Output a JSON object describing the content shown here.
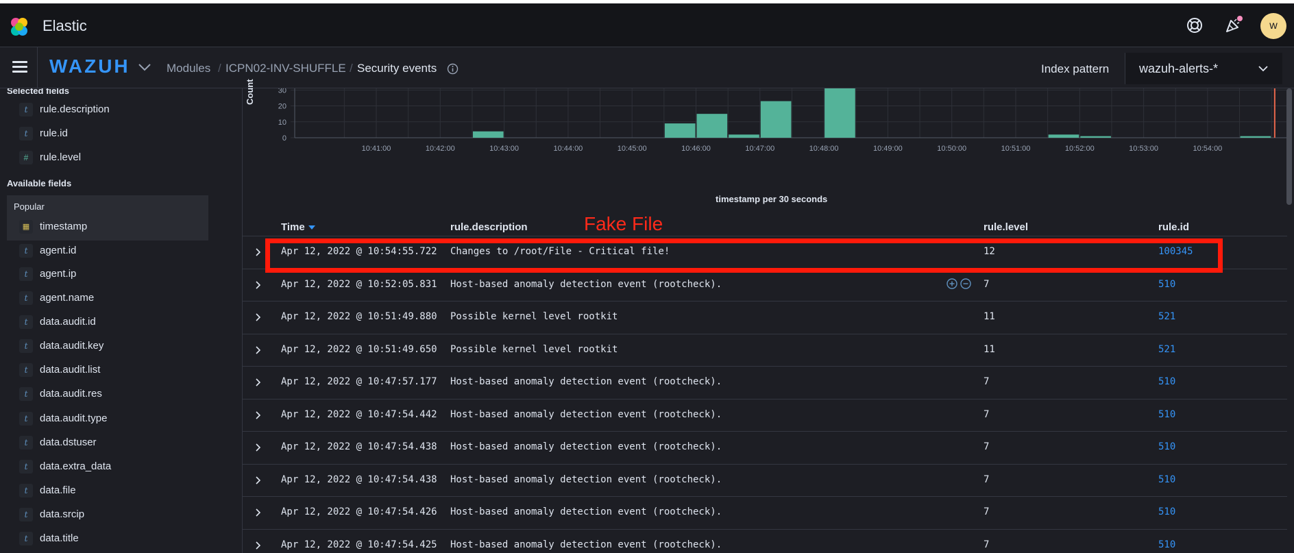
{
  "header": {
    "brand": "Elastic",
    "icons": [
      "help-icon",
      "news-feed-icon"
    ],
    "avatar_initial": "w"
  },
  "nav": {
    "app_name": "WAZUH",
    "breadcrumbs": [
      "Modules",
      "ICPN02-INV-SHUFFLE",
      "Security events"
    ],
    "index_pattern_label": "Index pattern",
    "index_pattern_value": "wazuh-alerts-*"
  },
  "sidebar": {
    "selected_heading": "Selected fields",
    "selected_fields": [
      {
        "name": "rule.description",
        "type": "t"
      },
      {
        "name": "rule.id",
        "type": "t"
      },
      {
        "name": "rule.level",
        "type": "#"
      }
    ],
    "available_heading": "Available fields",
    "popular_label": "Popular",
    "available_fields": [
      {
        "name": "timestamp",
        "type": "date"
      },
      {
        "name": "agent.id",
        "type": "t"
      },
      {
        "name": "agent.ip",
        "type": "t"
      },
      {
        "name": "agent.name",
        "type": "t"
      },
      {
        "name": "data.audit.id",
        "type": "t"
      },
      {
        "name": "data.audit.key",
        "type": "t"
      },
      {
        "name": "data.audit.list",
        "type": "t"
      },
      {
        "name": "data.audit.res",
        "type": "t"
      },
      {
        "name": "data.audit.type",
        "type": "t"
      },
      {
        "name": "data.dstuser",
        "type": "t"
      },
      {
        "name": "data.extra_data",
        "type": "t"
      },
      {
        "name": "data.file",
        "type": "t"
      },
      {
        "name": "data.srcip",
        "type": "t"
      },
      {
        "name": "data.title",
        "type": "t"
      }
    ]
  },
  "chart_data": {
    "type": "bar",
    "xlabel": "timestamp per 30 seconds",
    "ylabel": "Count",
    "ylim": [
      0,
      31
    ],
    "yticks": [
      0,
      10,
      20,
      30
    ],
    "xticks": [
      "10:41:00",
      "10:42:00",
      "10:43:00",
      "10:44:00",
      "10:45:00",
      "10:46:00",
      "10:47:00",
      "10:48:00",
      "10:49:00",
      "10:50:00",
      "10:51:00",
      "10:52:00",
      "10:53:00",
      "10:54:00"
    ],
    "bucket_minutes_from_1040": [
      2.75,
      5.75,
      6.25,
      6.75,
      7.25,
      8.25,
      11.75,
      12.25,
      14.75
    ],
    "values": [
      4,
      9,
      15,
      2,
      23,
      31,
      2,
      1,
      1
    ],
    "bar_color": "#54b399",
    "marker_color": "#e7664c"
  },
  "table": {
    "columns": [
      "Time",
      "rule.description",
      "rule.level",
      "rule.id"
    ],
    "rows": [
      {
        "time": "Apr 12, 2022 @ 10:54:55.722",
        "description": "Changes to /root/File - Critical file!",
        "level": "12",
        "id": "100345"
      },
      {
        "time": "Apr 12, 2022 @ 10:52:05.831",
        "description": "Host-based anomaly detection event (rootcheck).",
        "level": "7",
        "id": "510"
      },
      {
        "time": "Apr 12, 2022 @ 10:51:49.880",
        "description": "Possible kernel level rootkit",
        "level": "11",
        "id": "521"
      },
      {
        "time": "Apr 12, 2022 @ 10:51:49.650",
        "description": "Possible kernel level rootkit",
        "level": "11",
        "id": "521"
      },
      {
        "time": "Apr 12, 2022 @ 10:47:57.177",
        "description": "Host-based anomaly detection event (rootcheck).",
        "level": "7",
        "id": "510"
      },
      {
        "time": "Apr 12, 2022 @ 10:47:54.442",
        "description": "Host-based anomaly detection event (rootcheck).",
        "level": "7",
        "id": "510"
      },
      {
        "time": "Apr 12, 2022 @ 10:47:54.438",
        "description": "Host-based anomaly detection event (rootcheck).",
        "level": "7",
        "id": "510"
      },
      {
        "time": "Apr 12, 2022 @ 10:47:54.438",
        "description": "Host-based anomaly detection event (rootcheck).",
        "level": "7",
        "id": "510"
      },
      {
        "time": "Apr 12, 2022 @ 10:47:54.426",
        "description": "Host-based anomaly detection event (rootcheck).",
        "level": "7",
        "id": "510"
      },
      {
        "time": "Apr 12, 2022 @ 10:47:54.425",
        "description": "Host-based anomaly detection event (rootcheck).",
        "level": "7",
        "id": "510"
      }
    ]
  },
  "annotation": {
    "label": "Fake File",
    "color": "#ff1a0a"
  }
}
